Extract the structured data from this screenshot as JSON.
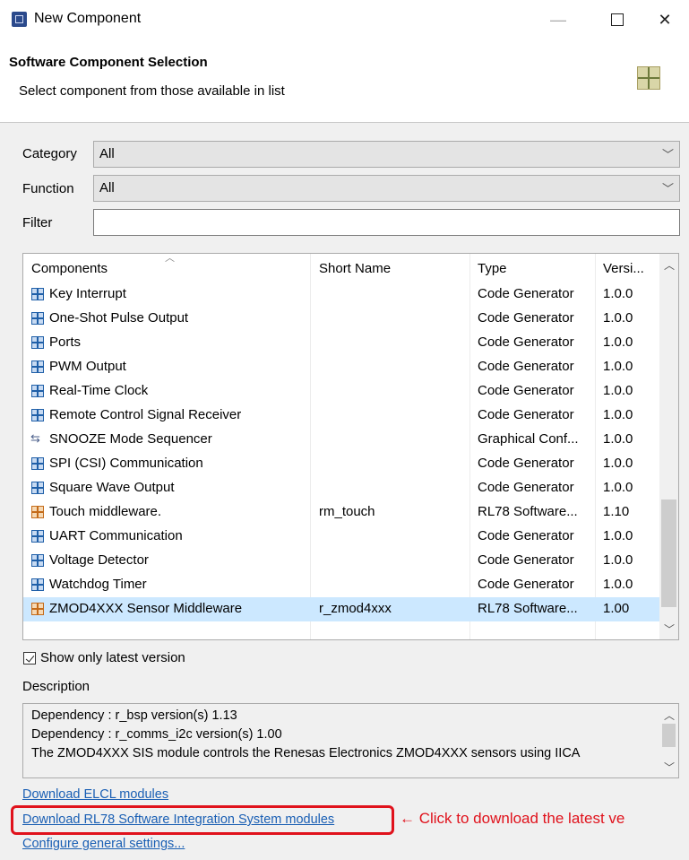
{
  "window": {
    "title": "New Component",
    "minimize_glyph": "—",
    "close_glyph": "✕"
  },
  "header": {
    "title": "Software Component Selection",
    "subtitle": "Select component from those available in list"
  },
  "filters": {
    "category_label": "Category",
    "category_value": "All",
    "function_label": "Function",
    "function_value": "All",
    "filter_label": "Filter",
    "filter_value": ""
  },
  "table": {
    "columns": [
      "Components",
      "Short Name",
      "Type",
      "Versi..."
    ],
    "rows": [
      {
        "name": "Key Interrupt",
        "short": "",
        "type": "Code Generator",
        "version": "1.0.0",
        "icon": "blue-component-icon"
      },
      {
        "name": "One-Shot Pulse Output",
        "short": "",
        "type": "Code Generator",
        "version": "1.0.0",
        "icon": "blue-component-icon"
      },
      {
        "name": "Ports",
        "short": "",
        "type": "Code Generator",
        "version": "1.0.0",
        "icon": "blue-component-icon"
      },
      {
        "name": "PWM Output",
        "short": "",
        "type": "Code Generator",
        "version": "1.0.0",
        "icon": "blue-component-icon"
      },
      {
        "name": "Real-Time Clock",
        "short": "",
        "type": "Code Generator",
        "version": "1.0.0",
        "icon": "blue-component-icon"
      },
      {
        "name": "Remote Control Signal Receiver",
        "short": "",
        "type": "Code Generator",
        "version": "1.0.0",
        "icon": "blue-component-icon"
      },
      {
        "name": "SNOOZE Mode Sequencer",
        "short": "",
        "type": "Graphical Conf...",
        "version": "1.0.0",
        "icon": "sequencer-icon"
      },
      {
        "name": "SPI (CSI) Communication",
        "short": "",
        "type": "Code Generator",
        "version": "1.0.0",
        "icon": "blue-component-icon"
      },
      {
        "name": "Square Wave Output",
        "short": "",
        "type": "Code Generator",
        "version": "1.0.0",
        "icon": "blue-component-icon"
      },
      {
        "name": "Touch middleware.",
        "short": "rm_touch",
        "type": "RL78 Software...",
        "version": "1.10",
        "icon": "orange-component-icon"
      },
      {
        "name": "UART Communication",
        "short": "",
        "type": "Code Generator",
        "version": "1.0.0",
        "icon": "blue-component-icon"
      },
      {
        "name": "Voltage Detector",
        "short": "",
        "type": "Code Generator",
        "version": "1.0.0",
        "icon": "blue-component-icon"
      },
      {
        "name": "Watchdog Timer",
        "short": "",
        "type": "Code Generator",
        "version": "1.0.0",
        "icon": "blue-component-icon"
      },
      {
        "name": "ZMOD4XXX Sensor Middleware",
        "short": "r_zmod4xxx",
        "type": "RL78 Software...",
        "version": "1.00",
        "icon": "orange-component-icon",
        "selected": true
      }
    ]
  },
  "options": {
    "show_latest_label": "Show only latest version",
    "show_latest_checked": true
  },
  "description": {
    "label": "Description",
    "lines": [
      "Dependency : r_bsp version(s) 1.13",
      "Dependency : r_comms_i2c version(s) 1.00",
      "The ZMOD4XXX SIS module controls the Renesas Electronics ZMOD4XXX sensors using IICA"
    ]
  },
  "links": {
    "download_elcl": "Download ELCL modules",
    "download_rl78": "Download RL78 Software Integration System modules",
    "configure": "Configure general settings..."
  },
  "annotation": {
    "callout": "← Click to download the latest ve",
    "color": "#e0121c"
  }
}
